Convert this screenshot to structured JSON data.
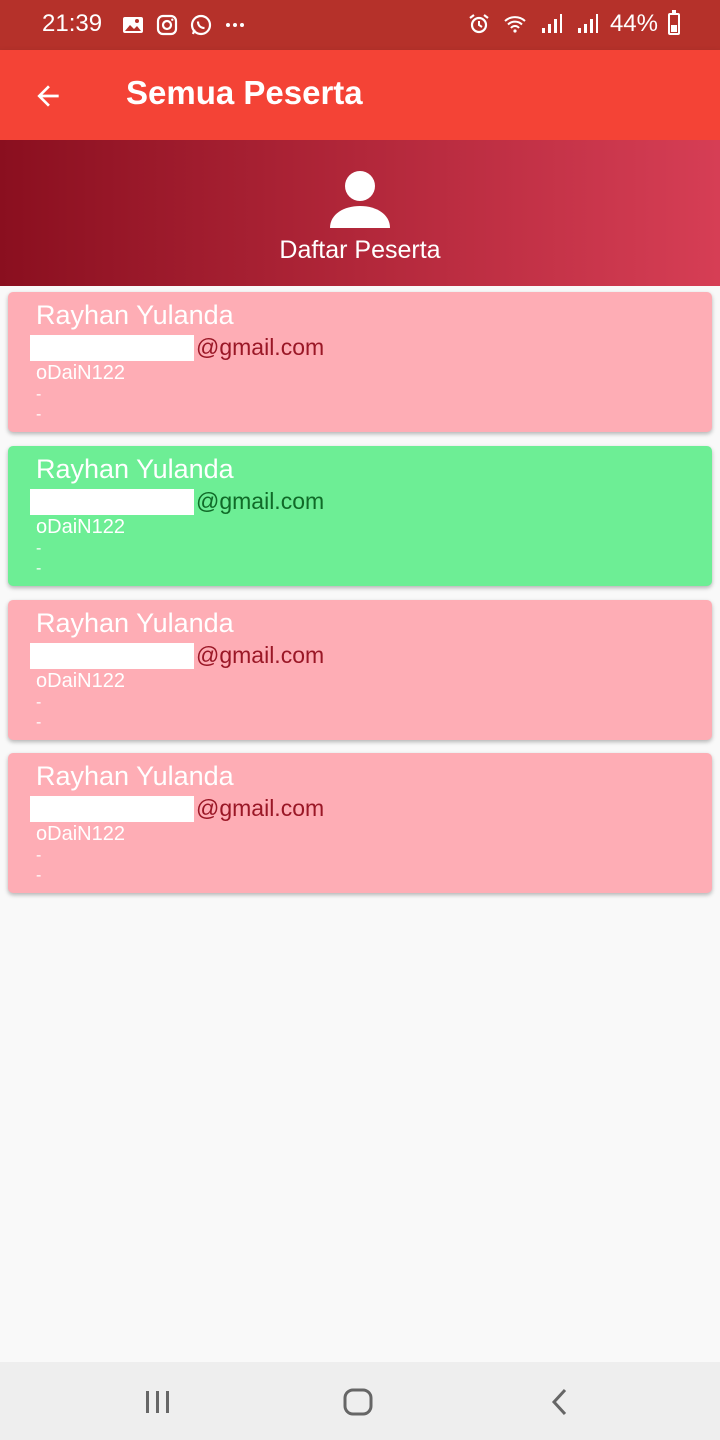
{
  "status_bar": {
    "time": "21:39",
    "battery": "44%",
    "left_icons": [
      "gallery-icon",
      "instagram-icon",
      "whatsapp-icon",
      "more-icon"
    ],
    "right_icons": [
      "alarm-icon",
      "wifi-icon",
      "signal-icon",
      "signal-icon",
      "battery-icon"
    ]
  },
  "app_bar": {
    "title": "Semua Peserta",
    "back_icon": "arrow-back-icon",
    "background": "#f44336"
  },
  "header": {
    "label": "Daftar Peserta",
    "icon": "person-icon"
  },
  "participants": [
    {
      "name": "Rayhan Yulanda",
      "email": "@gmail.com",
      "code": "oDaiN122",
      "extra1": "-",
      "extra2": "-",
      "status_color": "#feadb5"
    },
    {
      "name": "Rayhan Yulanda",
      "email": "@gmail.com",
      "code": "oDaiN122",
      "extra1": "-",
      "extra2": "-",
      "status_color": "#6dee95"
    },
    {
      "name": "Rayhan Yulanda",
      "email": "@gmail.com",
      "code": "oDaiN122",
      "extra1": "-",
      "extra2": "-",
      "status_color": "#feadb5"
    },
    {
      "name": "Rayhan Yulanda",
      "email": "@gmail.com",
      "code": "oDaiN122",
      "extra1": "-",
      "extra2": "-",
      "status_color": "#feadb5"
    }
  ],
  "nav_bar": {
    "buttons": [
      "recent-apps-icon",
      "home-icon",
      "back-icon"
    ]
  }
}
